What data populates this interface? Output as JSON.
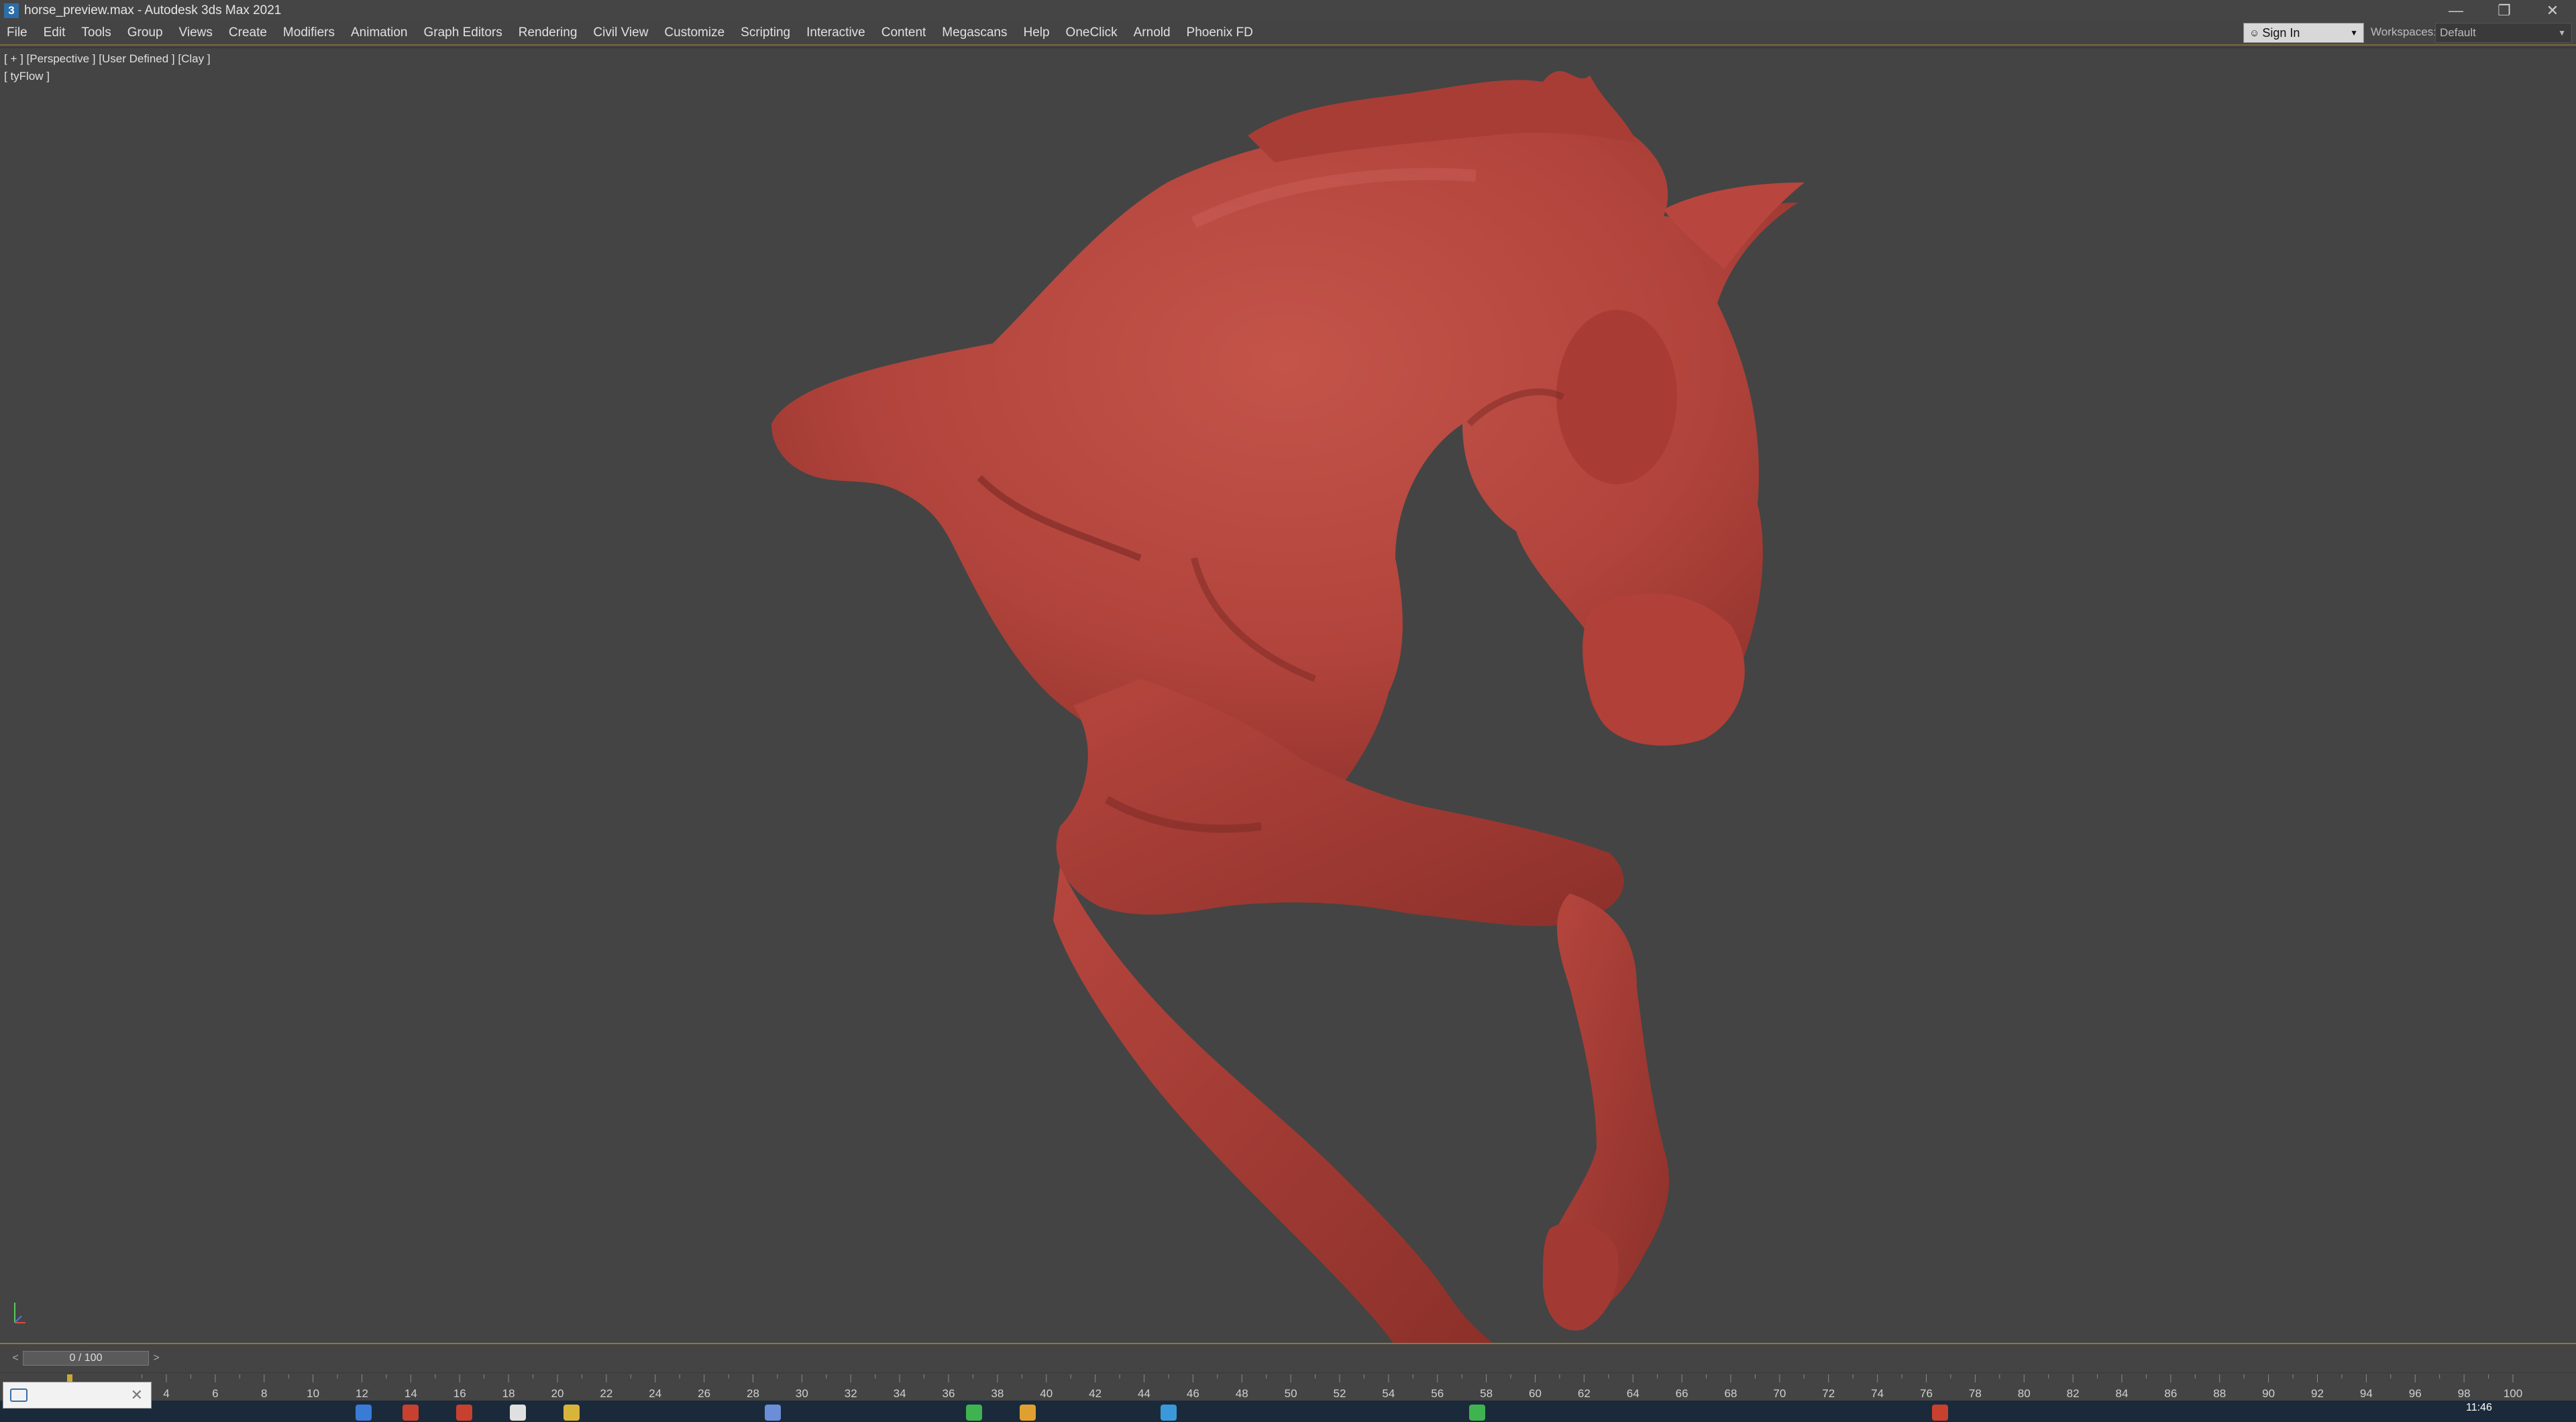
{
  "titlebar": {
    "app_icon": "3",
    "title": "horse_preview.max - Autodesk 3ds Max 2021",
    "buttons": {
      "minimize_icon": "minimize-icon",
      "restore_icon": "restore-icon",
      "close_icon": "close-icon"
    }
  },
  "menubar": {
    "items": [
      "File",
      "Edit",
      "Tools",
      "Group",
      "Views",
      "Create",
      "Modifiers",
      "Animation",
      "Graph Editors",
      "Rendering",
      "Civil View",
      "Customize",
      "Scripting",
      "Interactive",
      "Content",
      "Megascans",
      "Help",
      "OneClick",
      "Arnold",
      "Phoenix FD"
    ],
    "signin_label": "Sign In",
    "workspaces_label": "Workspaces:",
    "workspaces_value": "Default"
  },
  "viewport": {
    "label": "[ + ] [Perspective ] [User Defined ] [Clay ]",
    "tyflow_label": "[ tyFlow ]",
    "model_color": "#b8463e",
    "background_color": "#444444"
  },
  "timeslider": {
    "prev": "<",
    "frame": "0 / 100",
    "next": ">"
  },
  "trackbar": {
    "ticks": [
      "4",
      "6",
      "8",
      "10",
      "12",
      "14",
      "16",
      "18",
      "20",
      "22",
      "24",
      "26",
      "28",
      "30",
      "32",
      "34",
      "36",
      "38",
      "40",
      "42",
      "44",
      "46",
      "48",
      "50",
      "52",
      "54",
      "56",
      "58",
      "60",
      "62",
      "64",
      "66",
      "68",
      "70",
      "72",
      "74",
      "76",
      "78",
      "80",
      "82",
      "84",
      "86",
      "88",
      "90",
      "92",
      "94",
      "96",
      "98",
      "100"
    ]
  },
  "taskbar": {
    "clock": "11:46"
  }
}
